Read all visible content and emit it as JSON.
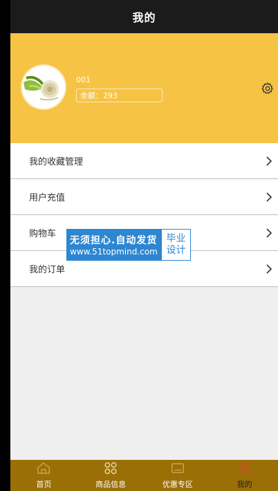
{
  "header": {
    "title": "我的"
  },
  "profile": {
    "user_id": "001",
    "balance_label": "余额：",
    "balance_value": "293"
  },
  "menu": [
    {
      "label": "我的收藏管理"
    },
    {
      "label": "用户充值"
    },
    {
      "label": "购物车"
    },
    {
      "label": "我的订单"
    }
  ],
  "watermark": {
    "line1": "无须担心.自动发货",
    "line2": "www.51topmind.com",
    "badge_line1": "毕业",
    "badge_line2": "设计"
  },
  "tabbar": [
    {
      "label": "首页",
      "icon": "home-icon",
      "active": false
    },
    {
      "label": "商品信息",
      "icon": "grid-icon",
      "active": false
    },
    {
      "label": "优惠专区",
      "icon": "card-icon",
      "active": false
    },
    {
      "label": "我的",
      "icon": "user-icon",
      "active": true
    }
  ],
  "colors": {
    "header_bg": "#1b1b1b",
    "profile_bg": "#f6c344",
    "tabbar_bg": "#9a6f06",
    "active_icon": "#e0422a",
    "watermark_blue": "#2c86d1"
  }
}
